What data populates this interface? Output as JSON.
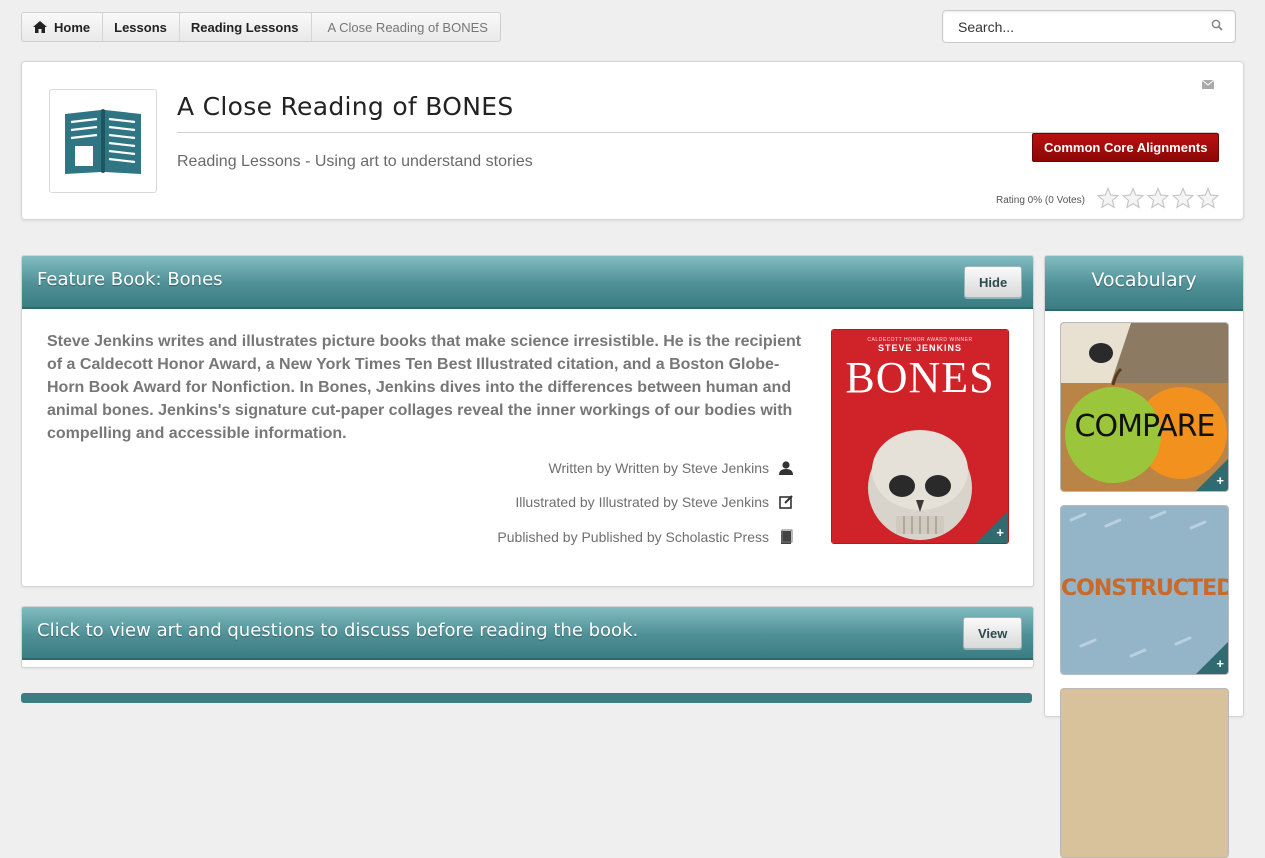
{
  "breadcrumb": {
    "items": [
      "Home",
      "Lessons",
      "Reading Lessons"
    ],
    "current": "A Close Reading of BONES"
  },
  "search": {
    "placeholder": "Search..."
  },
  "header": {
    "title": "A Close Reading of BONES",
    "subtitle": "Reading Lessons - Using art to understand stories",
    "cc_button": "Common Core Alignments",
    "rating_text": "Rating 0% (0 Votes)",
    "stars": 5,
    "rating_value": 0
  },
  "feature": {
    "title": "Feature Book: Bones",
    "hide_label": "Hide",
    "description": "Steve Jenkins writes and illustrates picture books that make science irresistible. He is the recipient of a Caldecott Honor Award, a New York Times Ten Best Illustrated citation, and a Boston Globe-Horn Book Award for Nonfiction. In Bones, Jenkins dives into the differences between human and animal bones. Jenkins's signature cut-paper collages reveal the inner workings of our bodies with compelling and accessible information.",
    "written_by": "Written by Written by Steve Jenkins",
    "illustrated_by": "Illustrated by Illustrated by Steve Jenkins",
    "published_by": "Published by Published by Scholastic Press",
    "cover": {
      "award": "CALDECOTT HONOR AWARD WINNER",
      "author": "STEVE JENKINS",
      "title": "BONES"
    }
  },
  "discuss": {
    "title": "Click to view art and questions to discuss before reading the book.",
    "view_label": "View"
  },
  "vocabulary": {
    "title": "Vocabulary",
    "words": [
      "COMPARE",
      "CONSTRUCTED"
    ]
  },
  "colors": {
    "teal": "#4e9096",
    "red": "#a00d0d"
  },
  "icons": {
    "home": "home-icon",
    "search": "search-icon",
    "mail": "mail-icon",
    "star": "star-icon",
    "author": "person-icon",
    "illustrator": "edit-icon",
    "publisher": "book-icon"
  }
}
